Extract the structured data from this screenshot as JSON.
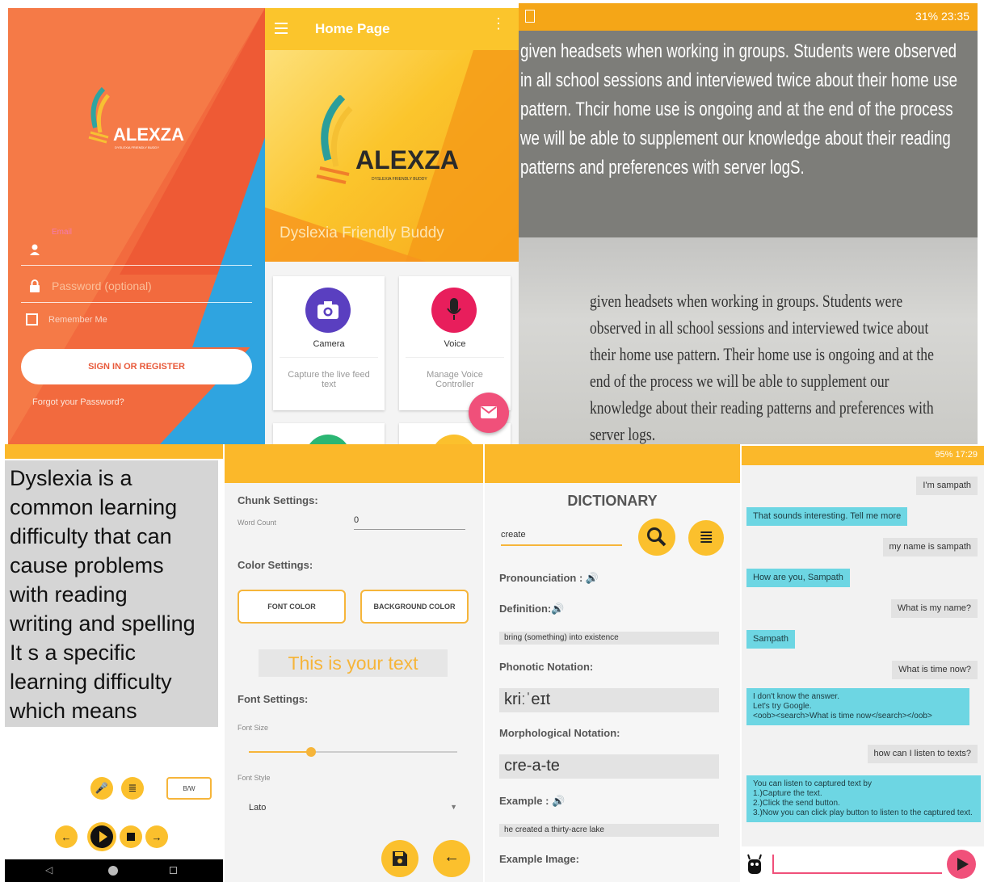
{
  "login": {
    "logo": "ALEXZA",
    "tagline": "DYSLEXIA FRIENDLY BUDDY",
    "email_label": "Email",
    "password_placeholder": "Password (optional)",
    "remember_label": "Remember Me",
    "signin_label": "SIGN IN OR REGISTER",
    "forgot_label": "Forgot your Password?"
  },
  "home": {
    "title": "Home Page",
    "logo": "ALEXZA",
    "logo_sub": "DYSLEXIA FRIENDLY BUDDY",
    "subtitle": "Dyslexia Friendly Buddy",
    "cards": [
      {
        "title": "Camera",
        "desc": "Capture the live feed text"
      },
      {
        "title": "Voice",
        "desc": "Manage Voice Controller"
      }
    ]
  },
  "photo": {
    "status_right": "31% 23:35",
    "ocr_text": "given headsets when working in groups. Students were observed in all school sessions and interviewed twice about their home use pattern. Thcir home use is ongoing and at the end of the process we will be able to supplement our knowledge about their reading patterns and preferences with server logS.",
    "printed_text": "given headsets when working in groups. Students were observed in all school sessions and interviewed twice about their home use pattern. Their home use is ongoing and at the end of the process we will be able to supplement our knowledge about their reading patterns and preferences with server logs."
  },
  "reader": {
    "text_lines": [
      "Dyslexia is a",
      "common learning",
      "difficulty that can",
      "cause problems",
      "with reading",
      "writing and spelling",
      "It s a specific",
      "learning difficulty",
      "which means"
    ],
    "toggle_label": "B/W"
  },
  "settings": {
    "chunk_label": "Chunk Settings:",
    "word_count_label": "Word Count",
    "word_count_value": "0",
    "color_label": "Color Settings:",
    "font_color_btn": "FONT COLOR",
    "bg_color_btn": "BACKGROUND COLOR",
    "preview_text": "This is your text",
    "font_label": "Font Settings:",
    "font_size_label": "Font Size",
    "font_size_value": 0.3,
    "font_style_label": "Font Style",
    "font_style_value": "Lato"
  },
  "dictionary": {
    "title": "DICTIONARY",
    "search_value": "create",
    "pronunciation_label": "Pronounciation :",
    "definition_label": "Definition:",
    "definition_value": "bring (something) into existence",
    "phonetic_label": "Phonotic Notation:",
    "phonetic_value": "kriːˈeɪt",
    "morph_label": "Morphological Notation:",
    "morph_value": "cre-a-te",
    "example_label": "Example :",
    "example_value": "he created a thirty-acre lake",
    "example_image_label": "Example Image:"
  },
  "chat": {
    "status_right": "95% 17:29",
    "messages": [
      {
        "from": "user",
        "text": "I'm sampath"
      },
      {
        "from": "bot",
        "text": "That sounds interesting.  Tell me more"
      },
      {
        "from": "user",
        "text": "my name is sampath"
      },
      {
        "from": "bot",
        "text": "How are you, Sampath"
      },
      {
        "from": "user",
        "text": "What is my name?"
      },
      {
        "from": "bot",
        "text": "Sampath"
      },
      {
        "from": "user",
        "text": "What is time now?"
      },
      {
        "from": "bot",
        "text": "I don't know the answer.\nLet's try Google.\n<oob><search>What is time now</search></oob>"
      },
      {
        "from": "user",
        "text": "how can I listen to texts?"
      },
      {
        "from": "bot",
        "text": "You can listen to captured text by\n        1.)Capture the text.\n        2.)Click the send button.\n        3.)Now you can click play button to listen to the captured text."
      }
    ],
    "input_value": ""
  },
  "colors": {
    "accent": "#fbb82a",
    "login_orange": "#f26a3e",
    "chat_bubble": "#6dd6e3",
    "fab_pink": "#f0507a"
  }
}
